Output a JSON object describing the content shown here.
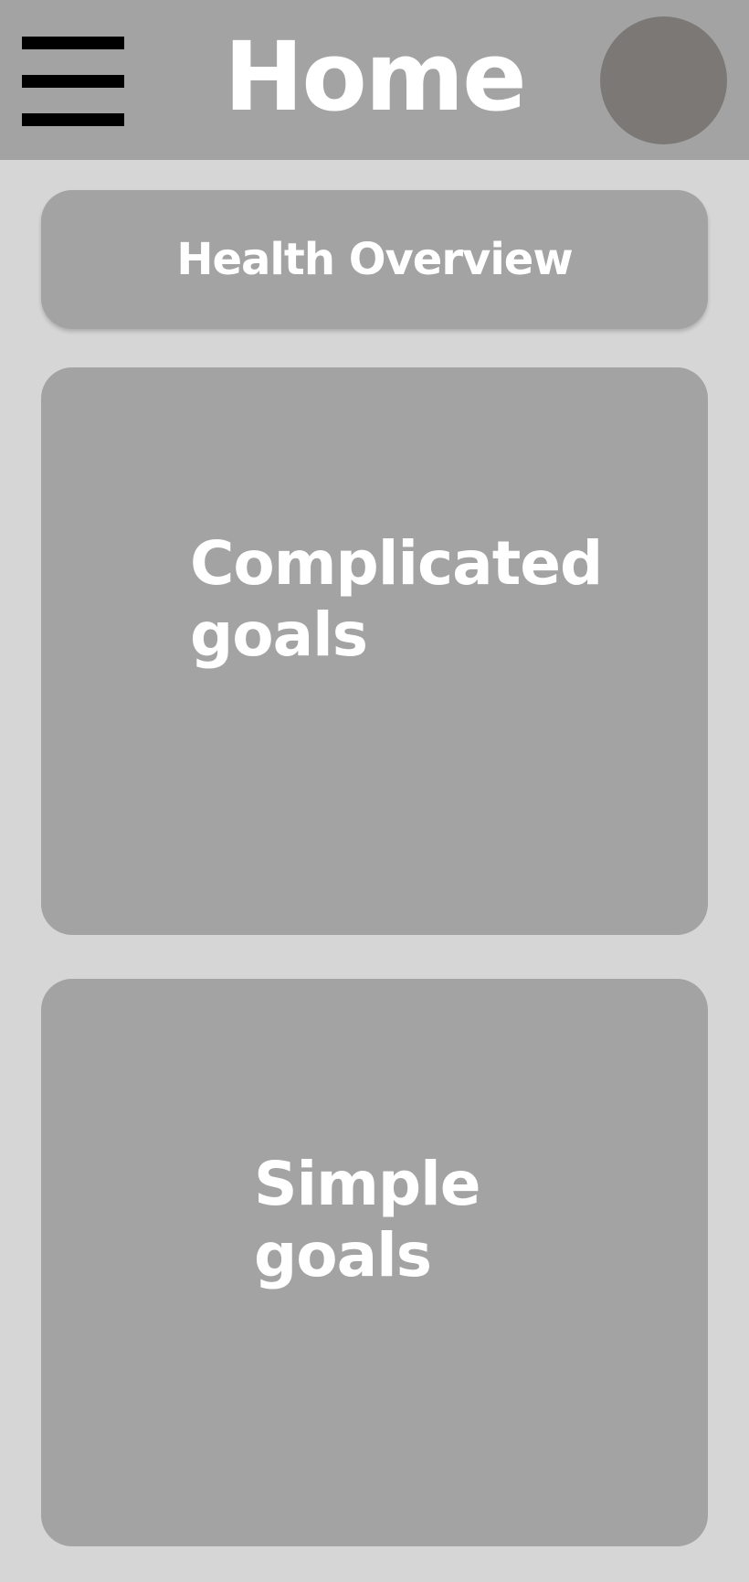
{
  "header": {
    "title": "Home",
    "menu_icon": "hamburger-menu-icon",
    "avatar": "user-avatar"
  },
  "cards": {
    "overview": {
      "label": "Health Overview"
    },
    "complicated": {
      "line1": "Complicated",
      "line2": "goals"
    },
    "simple": {
      "line1": "Simple",
      "line2": "goals"
    }
  },
  "colors": {
    "background": "#d6d6d6",
    "header": "#a3a3a3",
    "card": "#a3a3a3",
    "avatar": "#7c7876",
    "text": "#ffffff",
    "menu_icon": "#000000"
  }
}
